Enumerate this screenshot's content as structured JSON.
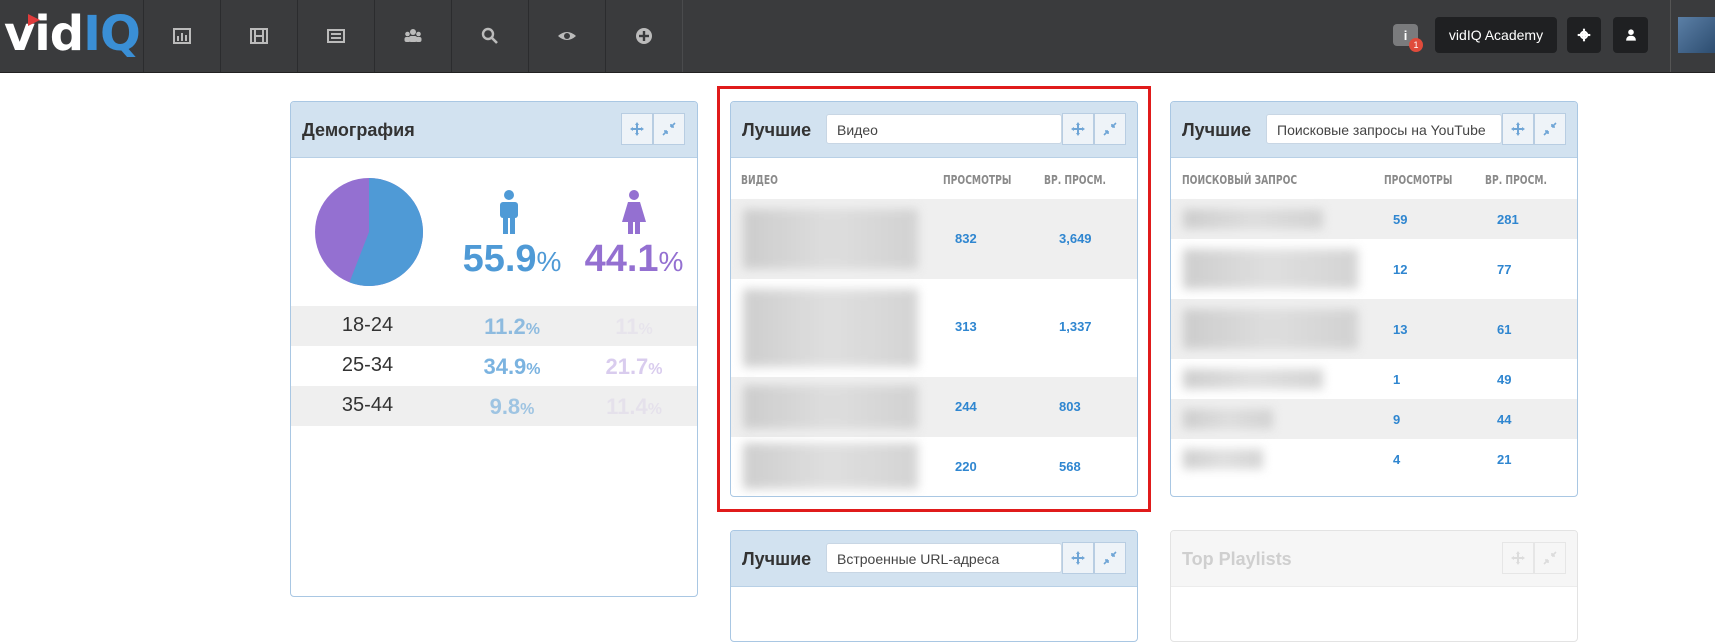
{
  "logo": {
    "text_vid": "vid",
    "text_iq": "IQ"
  },
  "nav": [
    {
      "icon": "bar-chart-icon"
    },
    {
      "icon": "film-icon"
    },
    {
      "icon": "list-icon"
    },
    {
      "icon": "users-icon"
    },
    {
      "icon": "search-icon"
    },
    {
      "icon": "eye-icon"
    },
    {
      "icon": "plus-circle-icon"
    }
  ],
  "header_right": {
    "info_badge": "1",
    "academy_label": "vidIQ Academy"
  },
  "demographics": {
    "title": "Демография",
    "male_pct": "55.9",
    "female_pct": "44.1",
    "pct_sign": "%",
    "male_share": 55.9,
    "rows": [
      {
        "age": "18-24",
        "male": "11.2",
        "female": "11"
      },
      {
        "age": "25-34",
        "male": "34.9",
        "female": "21.7"
      },
      {
        "age": "35-44",
        "male": "9.8",
        "female": "11.4"
      }
    ]
  },
  "top_videos": {
    "title": "Лучшие",
    "select": "Видео",
    "col_video": "ВИДЕО",
    "col_views": "ПРОСМОТРЫ",
    "col_watch": "ВР. ПРОСМ.",
    "rows": [
      {
        "views": "832",
        "watch": "3,649"
      },
      {
        "views": "313",
        "watch": "1,337"
      },
      {
        "views": "244",
        "watch": "803"
      },
      {
        "views": "220",
        "watch": "568"
      }
    ]
  },
  "top_search": {
    "title": "Лучшие",
    "select": "Поисковые запросы на YouTube",
    "col_query": "ПОИСКОВЫЙ ЗАПРОС",
    "col_views": "ПРОСМОТРЫ",
    "col_watch": "ВР. ПРОСМ.",
    "rows": [
      {
        "views": "59",
        "watch": "281"
      },
      {
        "views": "12",
        "watch": "77"
      },
      {
        "views": "13",
        "watch": "61"
      },
      {
        "views": "1",
        "watch": "49"
      },
      {
        "views": "9",
        "watch": "44"
      },
      {
        "views": "4",
        "watch": "21"
      }
    ]
  },
  "top_embedded": {
    "title": "Лучшие",
    "select": "Встроенные URL-адреса"
  },
  "top_playlists": {
    "title": "Top Playlists"
  },
  "colors": {
    "male": "#4f9ad6",
    "female": "#9470d1",
    "highlight": "#e01b1b"
  }
}
